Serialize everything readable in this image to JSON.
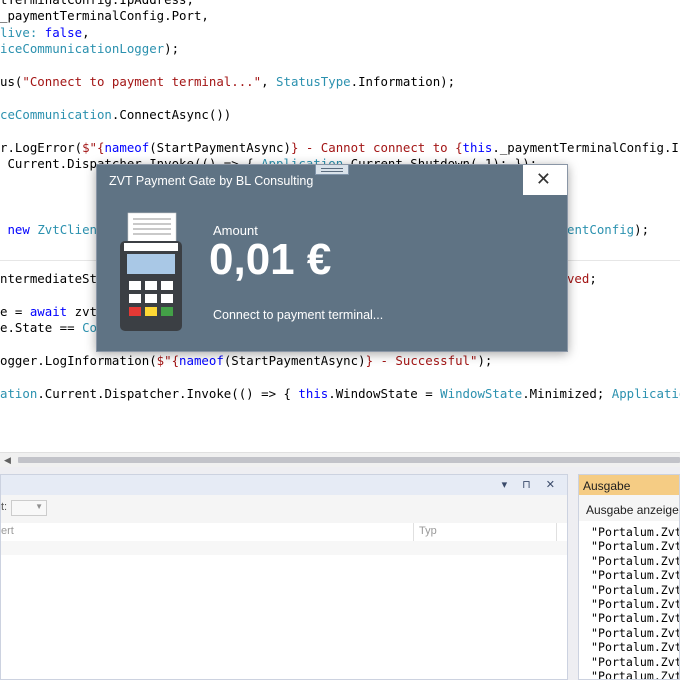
{
  "editor": {
    "lines": [
      [
        {
          "t": "tTerminalConfig.IpAddress,",
          "c": ""
        }
      ],
      [
        {
          "t": "_paymentTerminalConfig.Port,",
          "c": ""
        }
      ],
      [
        {
          "t": "live: ",
          "c": "t"
        },
        {
          "t": "false",
          "c": "k"
        },
        {
          "t": ",",
          "c": ""
        }
      ],
      [
        {
          "t": "iceCommunicationLogger",
          "c": "t"
        },
        {
          "t": ");",
          "c": ""
        }
      ],
      [
        {
          "t": "",
          "c": ""
        }
      ],
      [
        {
          "t": "us(",
          "c": ""
        },
        {
          "t": "\"Connect to payment terminal...\"",
          "c": "s"
        },
        {
          "t": ", ",
          "c": ""
        },
        {
          "t": "StatusType",
          "c": "t"
        },
        {
          "t": ".Information);",
          "c": ""
        }
      ],
      [
        {
          "t": "",
          "c": ""
        }
      ],
      [
        {
          "t": "ceCommunication",
          "c": "t"
        },
        {
          "t": ".ConnectAsync())",
          "c": ""
        }
      ],
      [
        {
          "t": "",
          "c": ""
        }
      ],
      [
        {
          "t": "r.LogError(",
          "c": ""
        },
        {
          "t": "$\"{",
          "c": "s"
        },
        {
          "t": "nameof",
          "c": "k"
        },
        {
          "t": "(StartPaymentAsync)",
          "c": ""
        },
        {
          "t": "} - Cannot connect to {",
          "c": "s"
        },
        {
          "t": "this",
          "c": "k"
        },
        {
          "t": "._paymentTerminalConfig.IpAd",
          "c": ""
        }
      ],
      [
        {
          "t": " Current.Dispatcher.Invoke(() => { ",
          "c": ""
        },
        {
          "t": "Application",
          "c": "t"
        },
        {
          "t": ".Current.Shutdown(-1); });",
          "c": ""
        }
      ],
      [
        {
          "t": "",
          "c": ""
        }
      ],
      [
        {
          "t": "",
          "c": ""
        }
      ],
      [
        {
          "t": "",
          "c": ""
        }
      ],
      [
        {
          "t": " ",
          "c": ""
        },
        {
          "t": "new",
          "c": "k"
        },
        {
          "t": " ",
          "c": ""
        },
        {
          "t": "ZvtClient",
          "c": "t"
        },
        {
          "t": "                                                            ",
          "c": ""
        },
        {
          "t": "lientConfig",
          "c": "t"
        },
        {
          "t": ");",
          "c": ""
        }
      ],
      [
        {
          "t": "",
          "c": ""
        }
      ],
      [
        {
          "t": "",
          "c": ""
        }
      ],
      [
        {
          "t": "ntermediateSta",
          "c": ""
        },
        {
          "t": "                                                             ",
          "c": ""
        },
        {
          "t": "ived",
          "c": "s"
        },
        {
          "t": ";",
          "c": ""
        }
      ],
      [
        {
          "t": "",
          "c": ""
        }
      ],
      [
        {
          "t": "e = ",
          "c": ""
        },
        {
          "t": "await",
          "c": "k"
        },
        {
          "t": " zvtC",
          "c": ""
        }
      ],
      [
        {
          "t": "e.State == ",
          "c": ""
        },
        {
          "t": "Com",
          "c": "t"
        }
      ],
      [
        {
          "t": "",
          "c": ""
        }
      ],
      [
        {
          "t": "ogger.LogInformation(",
          "c": ""
        },
        {
          "t": "$\"{",
          "c": "s"
        },
        {
          "t": "nameof",
          "c": "k"
        },
        {
          "t": "(StartPaymentAsync)",
          "c": ""
        },
        {
          "t": "} - Successful\"",
          "c": "s"
        },
        {
          "t": ");",
          "c": ""
        }
      ],
      [
        {
          "t": "",
          "c": ""
        }
      ],
      [
        {
          "t": "ation",
          "c": "t"
        },
        {
          "t": ".Current.Dispatcher.Invoke(() => { ",
          "c": ""
        },
        {
          "t": "this",
          "c": "k"
        },
        {
          "t": ".WindowState = ",
          "c": ""
        },
        {
          "t": "WindowState",
          "c": "t"
        },
        {
          "t": ".Minimized; ",
          "c": ""
        },
        {
          "t": "Application",
          "c": "t"
        },
        {
          "t": ".C",
          "c": ""
        }
      ]
    ]
  },
  "dialog": {
    "title": "ZVT Payment Gate by BL Consulting",
    "amount_label": "Amount",
    "amount_value": "0,01 €",
    "status_text": "Connect to payment terminal...",
    "close_icon": "close-icon"
  },
  "properties_panel": {
    "title_icons": "▾ ⊓ ✕",
    "toolbar_label": "t:",
    "col_value": "ert",
    "col_type": "Typ"
  },
  "output_panel": {
    "title": "Ausgabe",
    "toolbar_label": "Ausgabe anzeigen",
    "lines": [
      "\"Portalum.Zvt",
      "\"Portalum.Zvt",
      "\"Portalum.Zvt",
      "\"Portalum.Zvt",
      "\"Portalum.Zvt",
      "\"Portalum.Zvt",
      "\"Portalum.Zvt",
      "\"Portalum.Zvt",
      "\"Portalum.Zvt",
      "\"Portalum.Zvt",
      "\"Portalum.Zvt"
    ]
  },
  "colors": {
    "dialog_bg": "#5f7384",
    "output_title_bg": "#f5cc84",
    "keyword": "#0000ff",
    "type": "#2b91af",
    "string": "#a31515"
  }
}
